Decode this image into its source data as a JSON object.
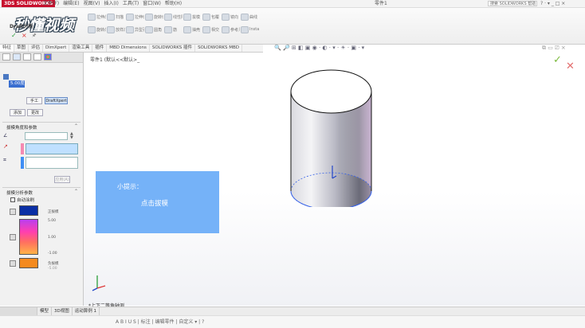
{
  "titlebar": {
    "logo": "3DS SOLIDWORKS",
    "menus": [
      "文件(F)",
      "编辑(E)",
      "视图(V)",
      "插入(I)",
      "工具(T)",
      "窗口(W)",
      "帮助(H)"
    ],
    "doc_title": "零件1",
    "search_placeholder": "搜索 SOLIDWORKS 帮助",
    "quick_buttons": "? · ▾ _ □ ×"
  },
  "watermark": "秒懂视频",
  "ribbon": {
    "commands": [
      "拉伸凸台/基体",
      "旋转凸台/基体",
      "扫描",
      "放样凸台/基体",
      "拉伸切除",
      "异型孔向导",
      "旋转切除",
      "圆角",
      "线性阵列",
      "筋",
      "拔模",
      "抽壳",
      "包覆",
      "相交",
      "镜向",
      "参考几何体",
      "曲线",
      "Instant3D"
    ]
  },
  "command_tabs": [
    "特征",
    "草图",
    "评估",
    "DimXpert",
    "渲染工具",
    "插件",
    "MBD Dimensions",
    "SOLIDWORKS 插件",
    "SOLIDWORKS MBD"
  ],
  "view_toolbar": "🔍 🔎 ⊞ ◧ ▣ ◉ · ◐ · ▾ · ☀ · ▣ · ▾",
  "window_controls": "⧉ ▭ ⎚ ×",
  "panel": {
    "tab_icons": [
      "feature-tree-icon",
      "property-manager-icon",
      "configuration-icon",
      "dimxpert-icon",
      "display-manager-icon"
    ],
    "title": "Draft分析",
    "help": "?",
    "ok": "✓",
    "cancel": "×",
    "pin": "🖈",
    "mode_buttons": [
      "手工",
      "DraftXpert"
    ],
    "sub_buttons": [
      "添加",
      "更改"
    ],
    "group1_title": "拔模角度和参数",
    "angle_value": "5.00度",
    "group1_btn": "应用(A)",
    "group2_title": "拔模分析参数",
    "checkbox_label": "自动涂刷",
    "legend": {
      "positive_label": "正拔模",
      "ticks": [
        "5.00",
        "1.00",
        "-1.00",
        "-5.00"
      ],
      "negative_label": "负拔模"
    }
  },
  "graphics": {
    "tree_label": "零件1 (默认<<默认>_",
    "hint_title": "小提示：",
    "hint_text": "点击拔模",
    "bottom_hint": "*上下二等角轴测"
  },
  "bottom_tabs": [
    "模型",
    "3D视图",
    "运动算例 1"
  ],
  "statusbar": "A B I U S | 标注 | 编辑零件 | 自定义 ▾ | ?",
  "colors": {
    "hint_bg": "#75b2f8",
    "positive": "#0a2fa5",
    "negative": "#f58a1f",
    "confirm_ok": "#7dbb3f",
    "confirm_cancel": "#e36f6f"
  }
}
